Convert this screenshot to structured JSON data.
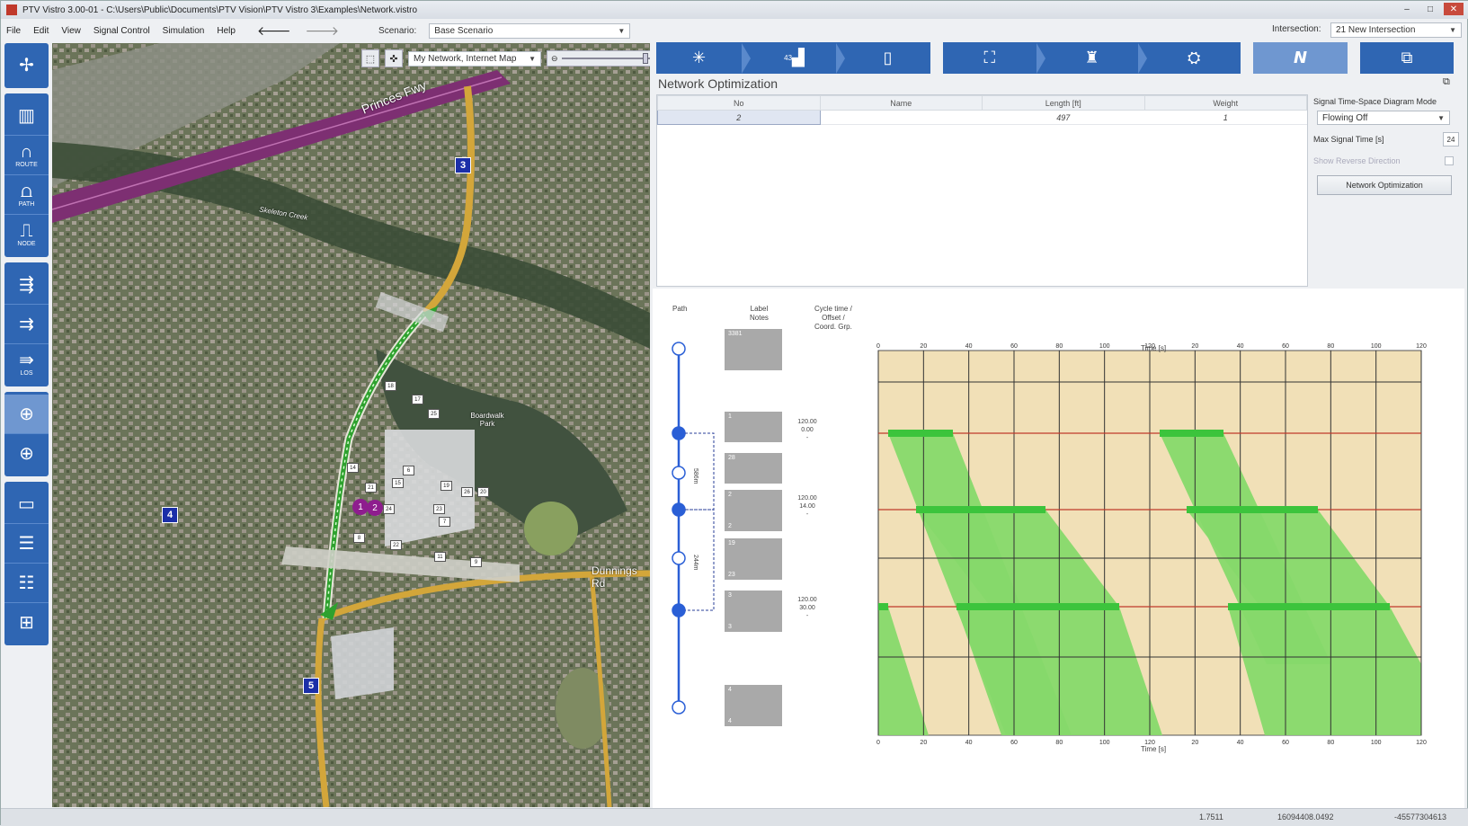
{
  "window": {
    "title": "PTV Vistro 3.00-01 - C:\\Users\\Public\\Documents\\PTV Vision\\PTV Vistro 3\\Examples\\Network.vistro"
  },
  "menu": {
    "items": [
      "File",
      "Edit",
      "View",
      "Signal Control",
      "Simulation",
      "Help"
    ],
    "scenario_label": "Scenario:",
    "scenario_value": "Base Scenario",
    "intersection_label": "Intersection:",
    "intersection_value": "21 New Intersection"
  },
  "left_toolbar": {
    "groups": [
      [
        {
          "icon": "intersection-icon",
          "glyph": "✢",
          "label": ""
        }
      ],
      [
        {
          "icon": "building-icon",
          "glyph": "▥",
          "label": ""
        },
        {
          "icon": "route-icon",
          "glyph": "∩",
          "label": "ROUTE"
        },
        {
          "icon": "path-icon",
          "glyph": "⩍",
          "label": "PATH"
        },
        {
          "icon": "node-icon",
          "glyph": "⎍",
          "label": "NODE"
        }
      ],
      [
        {
          "icon": "turn-volume-icon",
          "glyph": "⇶",
          "label": ""
        },
        {
          "icon": "lane-volume-icon",
          "glyph": "⇉",
          "label": ""
        },
        {
          "icon": "los-icon",
          "glyph": "⇛",
          "label": "LOS"
        }
      ],
      [
        {
          "icon": "signal-icon",
          "glyph": "⊕",
          "label": "",
          "active": true
        },
        {
          "icon": "signal-timing-icon",
          "glyph": "⊕",
          "label": ""
        }
      ],
      [
        {
          "icon": "report-icon",
          "glyph": "▭",
          "label": ""
        },
        {
          "icon": "table-icon",
          "glyph": "☰",
          "label": ""
        },
        {
          "icon": "export-icon",
          "glyph": "☷",
          "label": ""
        },
        {
          "icon": "import-icon",
          "glyph": "⊞",
          "label": ""
        }
      ]
    ]
  },
  "map": {
    "layer_value": "My Network, Internet Map",
    "labels": {
      "freeway": "Princes Fwy",
      "park": "Boardwalk Park",
      "creek": "Skeleton Creek",
      "road_east": "Dunnings Rd"
    },
    "markers": [
      "3",
      "4",
      "5"
    ],
    "purple_markers": [
      "1",
      "2"
    ],
    "tags": [
      "18",
      "17",
      "25",
      "14",
      "6",
      "21",
      "15",
      "19",
      "24",
      "23",
      "26",
      "20",
      "7",
      "8",
      "22",
      "11",
      "9"
    ]
  },
  "ribbon": {
    "group1": [
      {
        "icon": "network-icon",
        "glyph": "✳",
        "sub": ""
      },
      {
        "icon": "volume-icon",
        "glyph": "▟",
        "sub": "43"
      },
      {
        "icon": "signal-head-icon",
        "glyph": "▯",
        "sub": ""
      }
    ],
    "group2": [
      {
        "icon": "stairs-icon",
        "glyph": "⛶",
        "sub": ""
      },
      {
        "icon": "people-icon",
        "glyph": "♜",
        "sub": ""
      },
      {
        "icon": "report-icon",
        "glyph": "⛭",
        "sub": ""
      }
    ],
    "group3": [
      {
        "icon": "optimize-icon",
        "glyph": "𝙉",
        "sub": ""
      }
    ],
    "group4": [
      {
        "icon": "layers-icon",
        "glyph": "⧉",
        "sub": ""
      }
    ]
  },
  "network_optimization": {
    "title": "Network Optimization",
    "columns": [
      "No",
      "Name",
      "Length [ft]",
      "Weight"
    ],
    "rows": [
      [
        "2",
        "",
        "497",
        "1"
      ]
    ],
    "side": {
      "mode_label": "Signal Time-Space Diagram Mode",
      "mode_value": "Flowing Off",
      "max_signal_time_label": "Max Signal Time [s]",
      "max_signal_time_value": "24",
      "reverse_label": "Show Reverse Direction",
      "button_label": "Network Optimization"
    }
  },
  "time_space": {
    "headers": {
      "path": "Path",
      "label_notes": "Label\nNotes",
      "cycle": "Cycle time /\nOffset /\nCoord. Grp.",
      "time_top": "Time [s]",
      "time_bottom": "Time [s]"
    },
    "distances": [
      "586m",
      "244m"
    ],
    "notes": [
      {
        "top": "3381",
        "bottom": ""
      },
      {
        "top": "1",
        "bottom": ""
      },
      {
        "top": "28",
        "bottom": ""
      },
      {
        "top": "2",
        "bottom": "2"
      },
      {
        "top": "19",
        "bottom": "23"
      },
      {
        "top": "3",
        "bottom": "3"
      },
      {
        "top": "4",
        "bottom": "4"
      }
    ],
    "cycles": [
      {
        "cycle": "120.00",
        "offset": "0.00",
        "group": "-"
      },
      {
        "cycle": "120.00",
        "offset": "14.00",
        "group": "-"
      },
      {
        "cycle": "120.00",
        "offset": "30.00",
        "group": "-"
      }
    ],
    "axis_ticks": [
      "0",
      "20",
      "40",
      "60",
      "80",
      "100",
      "120",
      "20",
      "40",
      "60",
      "80",
      "100",
      "120"
    ],
    "colors": {
      "background": "#f1e0b7",
      "band": "#86d96a",
      "green_bar": "#3cc43c",
      "path_line": "#2a5fd6",
      "red_line": "#c0392b"
    }
  },
  "status": {
    "value1": "1.7511",
    "value2": "16094408.0492",
    "value3": "-45577304613"
  }
}
